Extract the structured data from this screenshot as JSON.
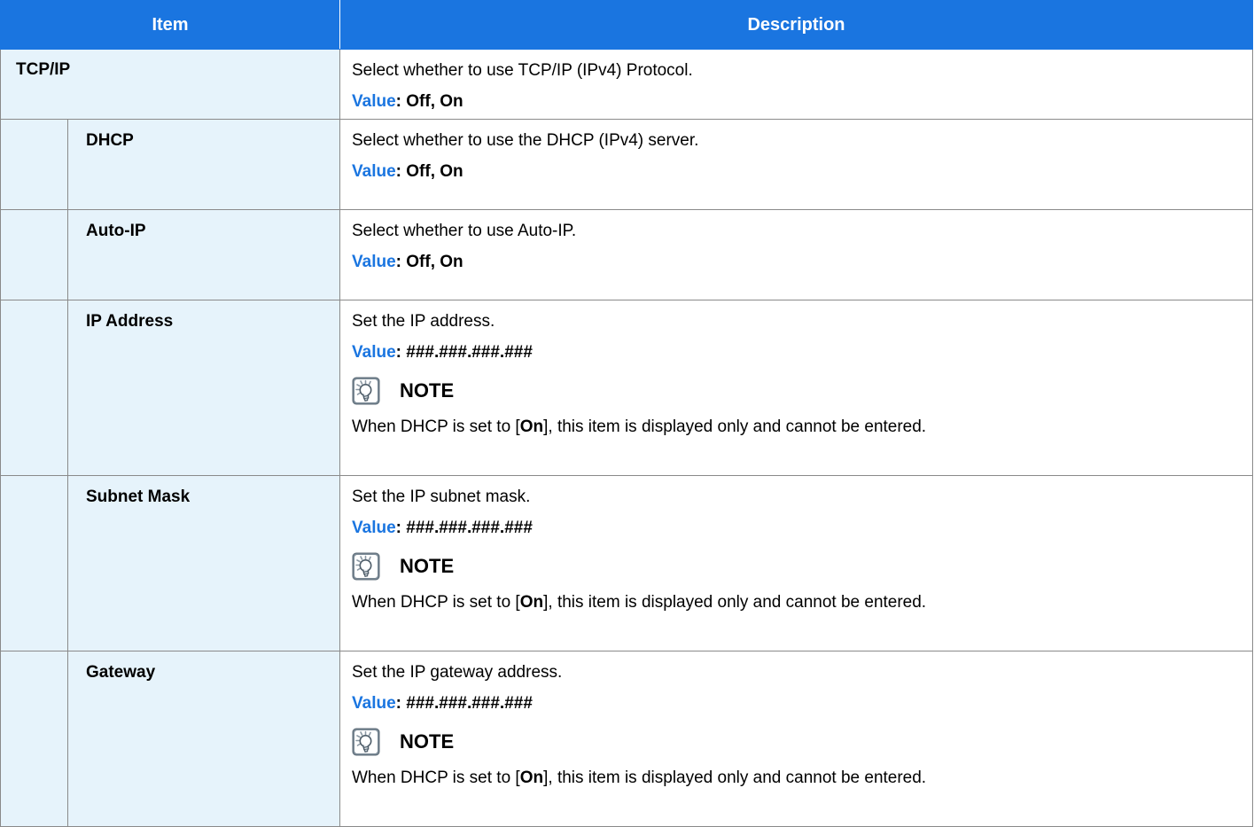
{
  "header": {
    "item_label": "Item",
    "description_label": "Description"
  },
  "value_label": "Value",
  "note_label": "NOTE",
  "rows": [
    {
      "item": "TCP/IP",
      "description": "Select whether to use TCP/IP (IPv4) Protocol.",
      "value": ": Off, On"
    },
    {
      "item": "DHCP",
      "description": "Select whether to use the DHCP (IPv4) server.",
      "value": ": Off, On"
    },
    {
      "item": "Auto-IP",
      "description": "Select whether to use Auto-IP.",
      "value": ": Off, On"
    },
    {
      "item": "IP Address",
      "description": "Set the IP address.",
      "value": ": ###.###.###.###",
      "note": {
        "prefix": "When DHCP is set to [",
        "emphasis": "On",
        "suffix": "], this item is displayed only and cannot be entered."
      }
    },
    {
      "item": "Subnet Mask",
      "description": "Set the IP subnet mask.",
      "value": ": ###.###.###.###",
      "note": {
        "prefix": "When DHCP is set to [",
        "emphasis": "On",
        "suffix": "], this item is displayed only and cannot be entered."
      }
    },
    {
      "item": "Gateway",
      "description": "Set the IP gateway address.",
      "value": ": ###.###.###.###",
      "note": {
        "prefix": "When DHCP is set to [",
        "emphasis": "On",
        "suffix": "], this item is displayed only and cannot be entered."
      }
    }
  ],
  "colors": {
    "header_bg": "#1a75e0",
    "header_text": "#ffffff",
    "item_cell_bg": "#e6f3fb",
    "value_label": "#1a75e0",
    "border": "#8a8a8a"
  },
  "icons": {
    "note": "note-lightbulb-icon"
  }
}
